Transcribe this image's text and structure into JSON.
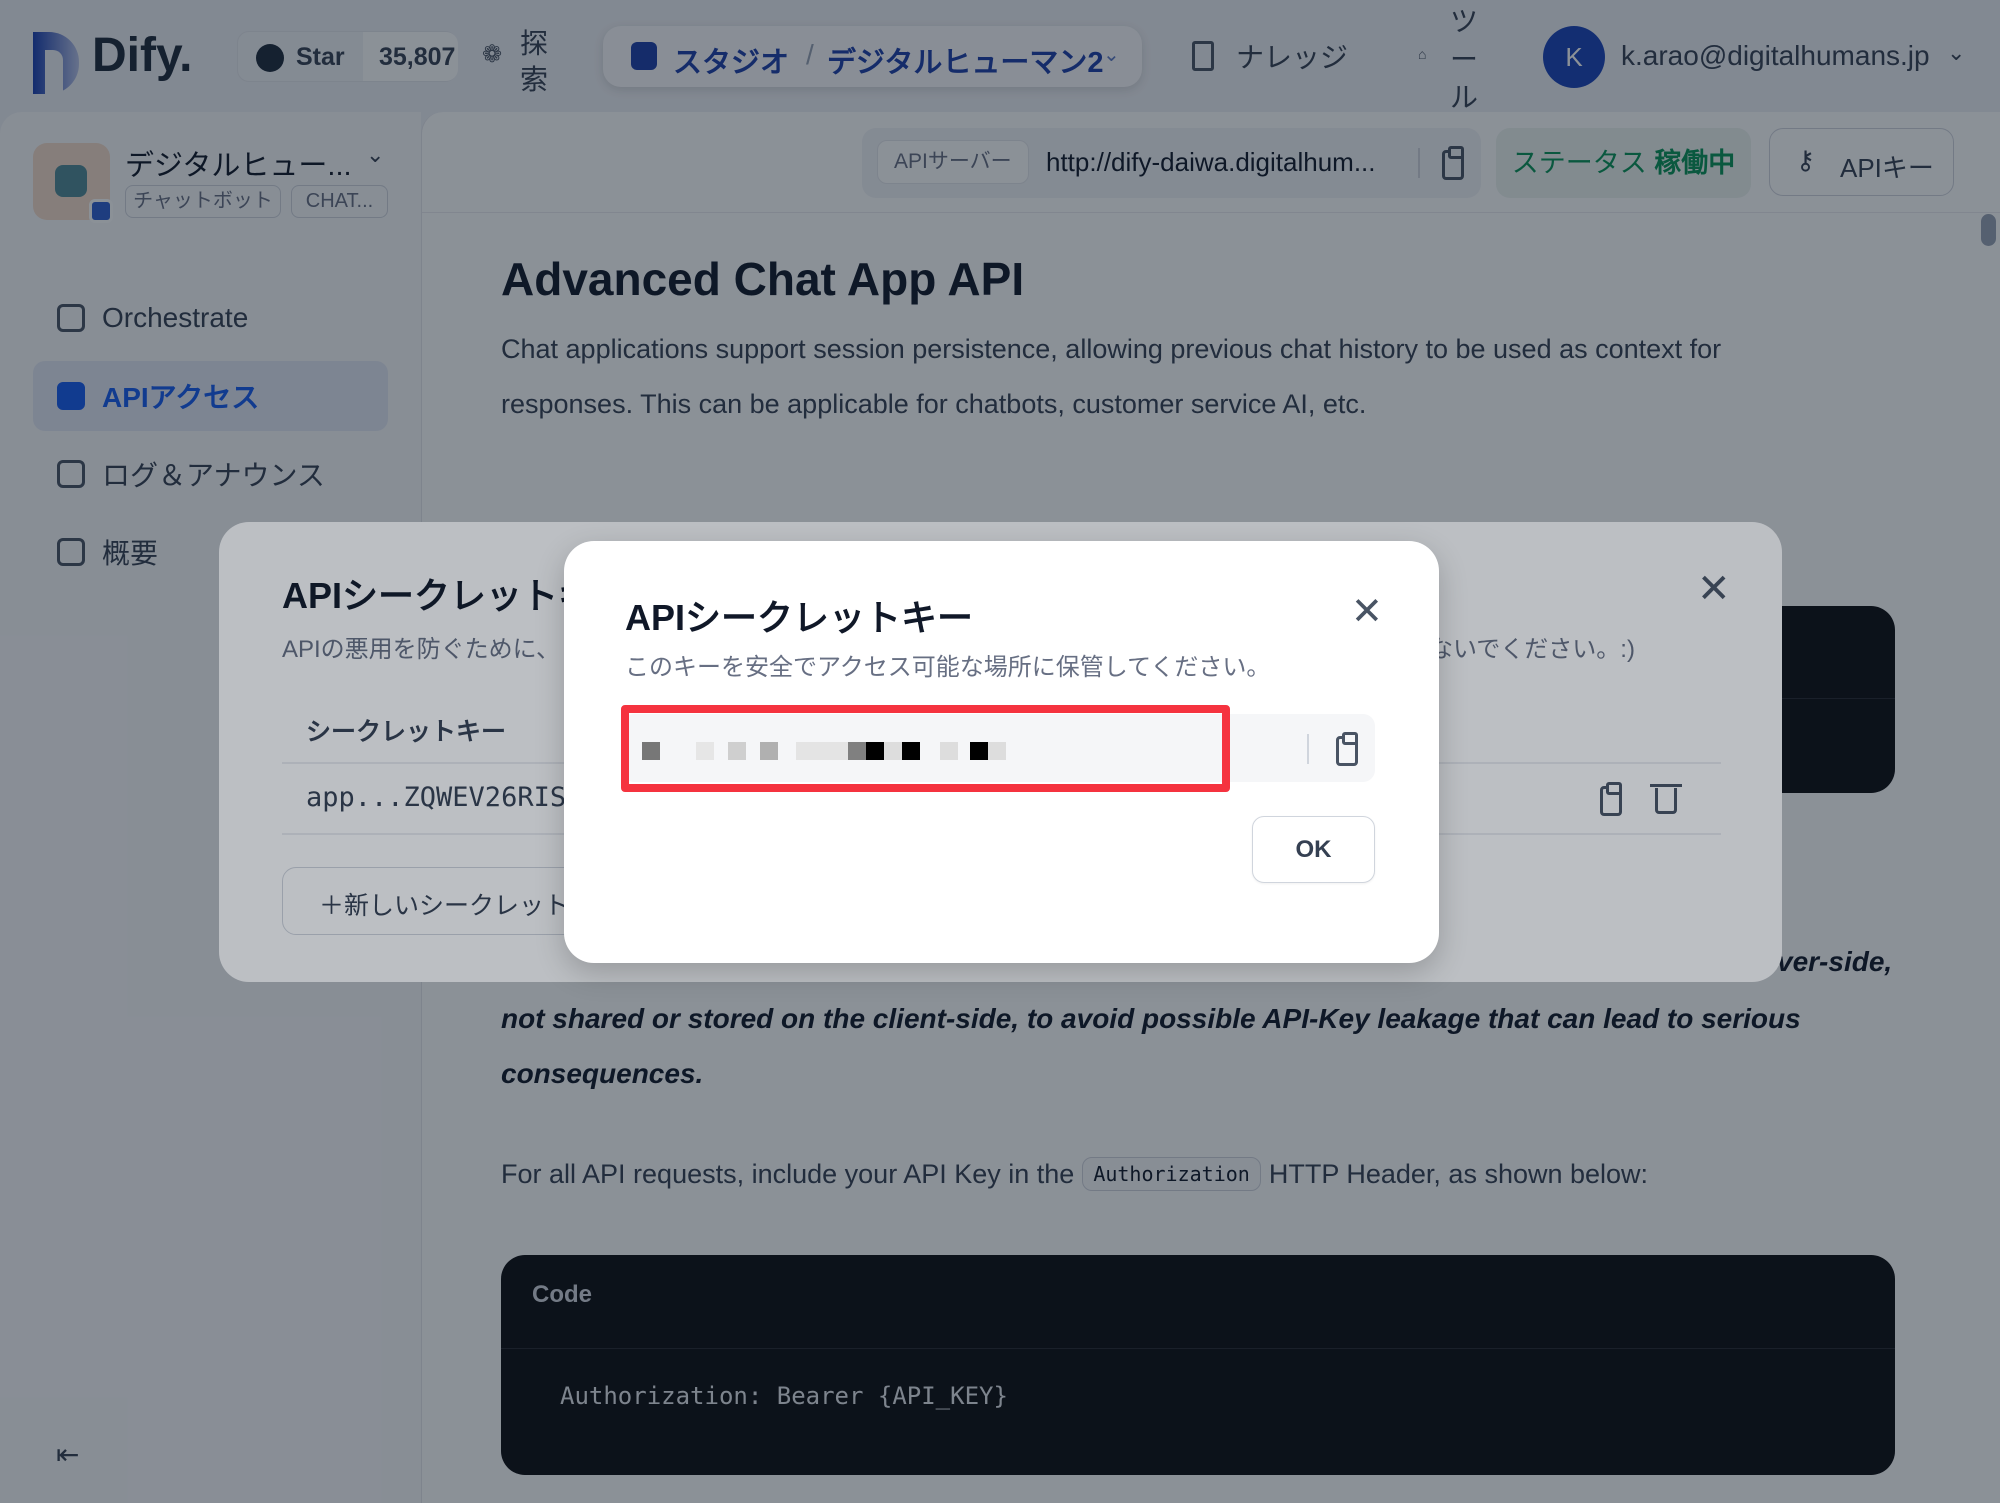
{
  "header": {
    "logo": "Dify.",
    "github_star_label": "Star",
    "github_star_count": "35,807",
    "explore_chars": [
      "探",
      "索"
    ],
    "studio_label": "スタジオ",
    "breadcrumb_separator": "/",
    "app_name": "デジタルヒューマン2",
    "knowledge_label": "ナレッジ",
    "tools_chars": [
      "ツ",
      "ー",
      "ル"
    ],
    "avatar_initial": "K",
    "user_email": "k.arao@digitalhumans.jp"
  },
  "sidebar": {
    "app_name": "デジタルヒュー...",
    "tags": [
      "チャットボット",
      "CHAT..."
    ],
    "items": [
      {
        "label": "Orchestrate",
        "icon": "orchestrate-icon",
        "active": false
      },
      {
        "label": "APIアクセス",
        "icon": "terminal-icon",
        "active": true
      },
      {
        "label": "ログ＆アナウンス",
        "icon": "log-icon",
        "active": false
      },
      {
        "label": "概要",
        "icon": "chart-icon",
        "active": false
      }
    ]
  },
  "api_bar": {
    "server_label": "APIサーバー",
    "server_url": "http://dify-daiwa.digitalhum...",
    "status_label": "ステータス",
    "status_value": "稼働中",
    "api_key_button": "APIキー"
  },
  "doc": {
    "title": "Advanced Chat App API",
    "intro_line1": "Chat applications support session persistence, allowing previous chat history to be used as context for",
    "intro_line2": "responses. This can be applicable for chatbots, customer service AI, etc.",
    "warning_tail": "ver-side,",
    "warning_line2": "not shared or stored on the client-side, to avoid possible API-Key leakage that can lead to serious",
    "warning_line3": "consequences.",
    "auth_before": "For all API requests, include your API Key in the",
    "auth_code": "Authorization",
    "auth_after": "HTTP Header, as shown below:",
    "code_header": "Code",
    "code_body": "Authorization: Bearer {API_KEY}"
  },
  "outer_modal": {
    "title": "APIシークレットキー",
    "desc_left": "APIの悪用を防ぐために、",
    "desc_right": "ないでください。:)",
    "column_header": "シークレットキー",
    "row_key": "app...ZQWEV26RIS",
    "new_key_button": "＋新しいシークレットキー"
  },
  "inner_modal": {
    "title": "APIシークレットキー",
    "desc": "このキーを安全でアクセス可能な場所に保管してください。",
    "ok_button": "OK",
    "highlight_color": "#f5333f"
  },
  "colors": {
    "accent": "#155aef",
    "brand_blue": "#1c3fa8",
    "status_green": "#079455",
    "code_bg": "#0c0d10"
  }
}
